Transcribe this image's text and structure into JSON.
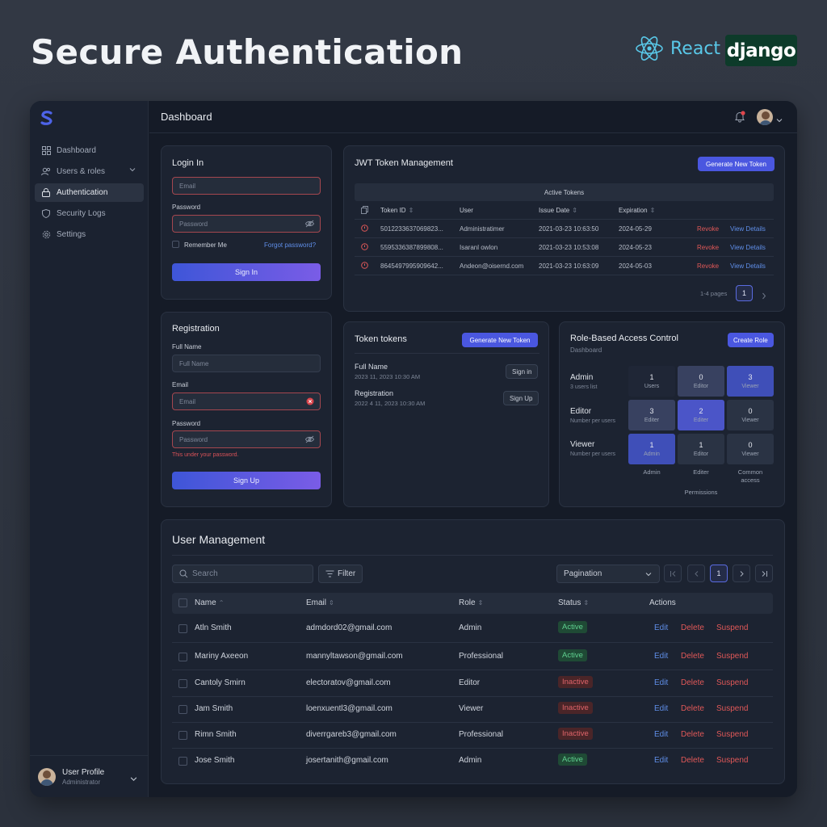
{
  "hero": {
    "title": "Secure Authentication",
    "react": "React",
    "django": "django"
  },
  "sidebar": {
    "items": [
      {
        "label": "Dashboard",
        "icon": "grid-icon"
      },
      {
        "label": "Users & roles",
        "icon": "users-icon"
      },
      {
        "label": "Authentication",
        "icon": "lock-icon"
      },
      {
        "label": "Security Logs",
        "icon": "shield-icon"
      },
      {
        "label": "Settings",
        "icon": "gear-icon"
      }
    ],
    "profile": {
      "name": "User Profile",
      "role": "Administrator"
    }
  },
  "topbar": {
    "title": "Dashboard"
  },
  "login": {
    "title": "Login In",
    "email_placeholder": "Email",
    "password_label": "Password",
    "password_placeholder": "Password",
    "remember": "Remember Me",
    "forgot": "Forgot password?",
    "submit": "Sign In"
  },
  "registration": {
    "title": "Registration",
    "fullname_label": "Full Name",
    "fullname_placeholder": "Full Name",
    "email_label": "Email",
    "email_placeholder": "Email",
    "password_label": "Password",
    "password_placeholder": "Password",
    "error": "This under your password.",
    "submit": "Sign Up"
  },
  "jwt": {
    "title": "JWT Token Management",
    "generate": "Generate New Token",
    "table_caption": "Active Tokens",
    "headers": [
      "Token ID",
      "User",
      "Issue Date",
      "Expiration"
    ],
    "rows": [
      {
        "id": "5012233637069823...",
        "user": "Administratimer",
        "issued": "2021-03-23 10:63:50",
        "exp": "2024-05-29",
        "revoke": "Revoke",
        "view": "View Details"
      },
      {
        "id": "5595336387899808...",
        "user": "Isaranl owlon",
        "issued": "2021-03-23 10:53:08",
        "exp": "2024-05-23",
        "revoke": "Revoke",
        "view": "View Details"
      },
      {
        "id": "8645497995909642...",
        "user": "Andeon@oisernd.com",
        "issued": "2021-03-23 10:63:09",
        "exp": "2024-05-03",
        "revoke": "Revoke",
        "view": "View Details"
      }
    ],
    "pages_label": "1-4 pages",
    "page": "1"
  },
  "tokens": {
    "title": "Token tokens",
    "generate": "Generate New Token",
    "items": [
      {
        "name": "Full Name",
        "date": "2023 11, 2023 10:30 AM",
        "action": "Sign in"
      },
      {
        "name": "Registration",
        "date": "2022 4 11, 2023 10:30 AM",
        "action": "Sign Up"
      }
    ]
  },
  "rbac": {
    "title": "Role-Based Access Control",
    "subtitle": "Dashboard",
    "create": "Create Role",
    "roles": [
      {
        "name": "Admin",
        "desc": "3 users list"
      },
      {
        "name": "Editor",
        "desc": "Number per users"
      },
      {
        "name": "Viewer",
        "desc": "Number per users"
      }
    ],
    "grid": [
      [
        {
          "n": "1",
          "t": "Users"
        },
        {
          "n": "0",
          "t": "Editor"
        },
        {
          "n": "3",
          "t": "Viewer"
        }
      ],
      [
        {
          "n": "3",
          "t": "Editer"
        },
        {
          "n": "2",
          "t": "Editer"
        },
        {
          "n": "0",
          "t": "Viewer"
        }
      ],
      [
        {
          "n": "1",
          "t": "Admin"
        },
        {
          "n": "1",
          "t": "Editor"
        },
        {
          "n": "0",
          "t": "Viewer"
        }
      ]
    ],
    "columns": [
      "Admin",
      "Editer",
      "Common access"
    ],
    "footer": "Permissions"
  },
  "users": {
    "title": "User Management",
    "search_placeholder": "Search",
    "filter": "Filter",
    "pagination": "Pagination",
    "page": "1",
    "headers": [
      "Name",
      "Email",
      "Role",
      "Status",
      "Actions"
    ],
    "rows": [
      {
        "name": "Atln Smith",
        "email": "admdord02@gmail.com",
        "role": "Admin",
        "status": "Active"
      },
      {
        "name": "Mariny Axeeon",
        "email": "mannyltawson@gmail.com",
        "role": "Professional",
        "status": "Active"
      },
      {
        "name": "Cantoly Smirn",
        "email": "electoratov@gmail.com",
        "role": "Editor",
        "status": "Inactive"
      },
      {
        "name": "Jam Smith",
        "email": "loenxuentl3@gmail.com",
        "role": "Viewer",
        "status": "Inactive"
      },
      {
        "name": "Rimn Smith",
        "email": "diverrgareb3@gmail.com",
        "role": "Professional",
        "status": "Inactive"
      },
      {
        "name": "Jose Smith",
        "email": "josertanith@gmail.com",
        "role": "Admin",
        "status": "Active"
      }
    ],
    "actions": {
      "edit": "Edit",
      "delete": "Delete",
      "suspend": "Suspend"
    }
  },
  "colors": {
    "accent": "#4a57e0",
    "danger": "#e05858",
    "success": "#5fd08f",
    "link": "#5f8ee8"
  }
}
